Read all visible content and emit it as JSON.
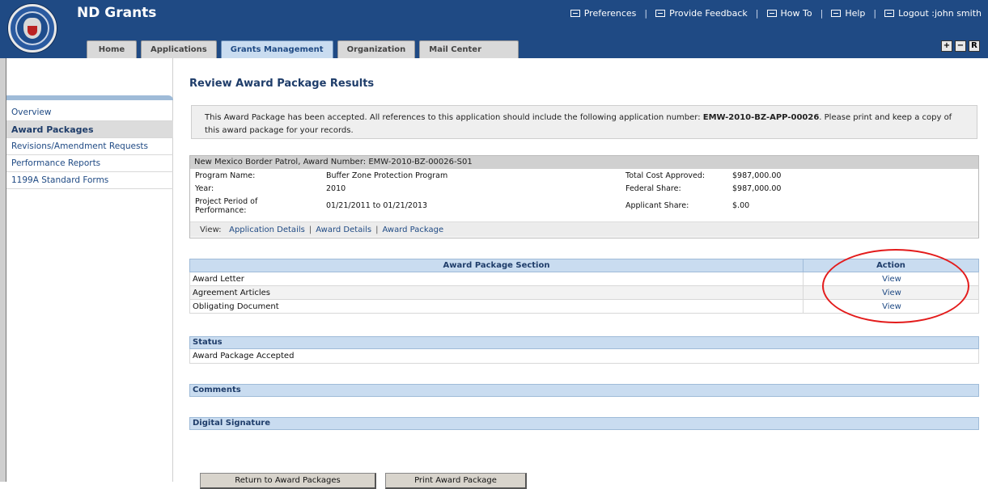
{
  "app": {
    "title": "ND Grants"
  },
  "util_nav": [
    {
      "label": "Preferences",
      "icon": "preferences-icon"
    },
    {
      "label": "Provide Feedback",
      "icon": "feedback-icon"
    },
    {
      "label": "How To",
      "icon": "howto-icon"
    },
    {
      "label": "Help",
      "icon": "help-icon"
    },
    {
      "label": "Logout :john smith",
      "icon": "logout-icon"
    }
  ],
  "tabs": [
    "Home",
    "Applications",
    "Grants Management",
    "Organization",
    "Mail Center"
  ],
  "active_tab": "Grants Management",
  "window_controls": [
    "+",
    "−",
    "R"
  ],
  "sidebar": {
    "items": [
      "Overview",
      "Award Packages",
      "Revisions/Amendment Requests",
      "Performance Reports",
      "1199A Standard Forms"
    ],
    "active": "Award Packages"
  },
  "page": {
    "title": "Review Award Package Results"
  },
  "notice": {
    "before": "This Award Package has been accepted. All references to this application should include the following application number: ",
    "app_number": "EMW-2010-BZ-APP-00026",
    "after": ". Please print and keep a copy of this award package for your records."
  },
  "award": {
    "header": "New Mexico Border Patrol, Award Number: EMW-2010-BZ-00026-S01",
    "rows": [
      {
        "label": "Program Name:",
        "value": "Buffer Zone Protection Program",
        "label2": "Total Cost Approved:",
        "value2": "$987,000.00"
      },
      {
        "label": "Year:",
        "value": "2010",
        "label2": "Federal Share:",
        "value2": "$987,000.00"
      },
      {
        "label": "Project Period of Performance:",
        "value": "01/21/2011 to 01/21/2013",
        "label2": "Applicant Share:",
        "value2": "$.00"
      }
    ],
    "view_label": "View:",
    "view_links": [
      "Application Details",
      "Award Details",
      "Award Package"
    ]
  },
  "package_table": {
    "headers": [
      "Award Package Section",
      "Action"
    ],
    "rows": [
      {
        "section": "Award Letter",
        "action": "View"
      },
      {
        "section": "Agreement Articles",
        "action": "View"
      },
      {
        "section": "Obligating Document",
        "action": "View"
      }
    ]
  },
  "status": {
    "header": "Status",
    "value": "Award Package Accepted"
  },
  "comments": {
    "header": "Comments"
  },
  "digital_signature": {
    "header": "Digital Signature"
  },
  "buttons": {
    "return": "Return to Award Packages",
    "print": "Print Award Package"
  },
  "colors": {
    "header_bg": "#1f4a84",
    "section_header_bg": "#c9dcf0",
    "link": "#1f4a84",
    "annotation": "#e31b1b"
  }
}
